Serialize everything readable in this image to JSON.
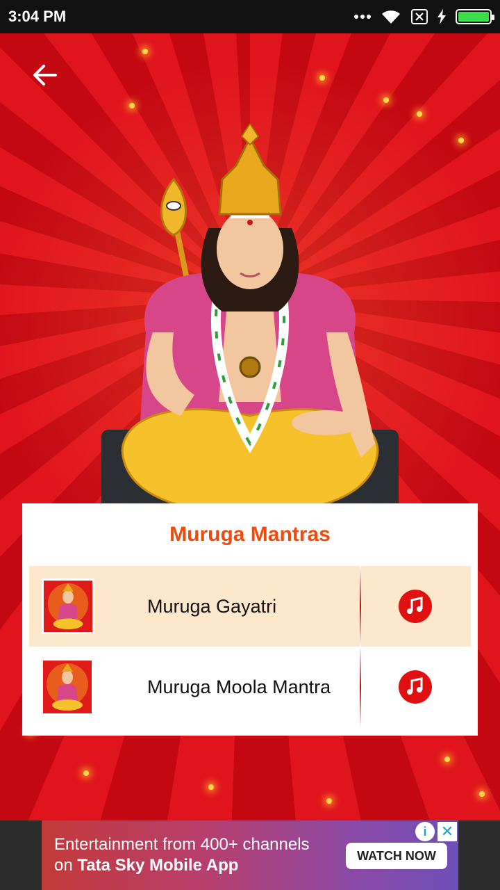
{
  "status_bar": {
    "time": "3:04 PM",
    "battery_percent": 100,
    "battery_color": "#3ddc4a"
  },
  "header": {
    "back_icon": "arrow-left-icon"
  },
  "card": {
    "title": "Muruga Mantras",
    "title_color": "#f04a0c",
    "items": [
      {
        "label": "Muruga Gayatri",
        "icon": "music-note-icon",
        "selected": true
      },
      {
        "label": "Muruga Moola Mantra",
        "icon": "music-note-icon",
        "selected": false
      }
    ]
  },
  "ad": {
    "line1": "Entertainment from 400+ channels",
    "line2_prefix": "on",
    "line2_brand": "Tata Sky Mobile App",
    "cta": "WATCH NOW",
    "info_glyph": "i",
    "close_glyph": "✕"
  }
}
